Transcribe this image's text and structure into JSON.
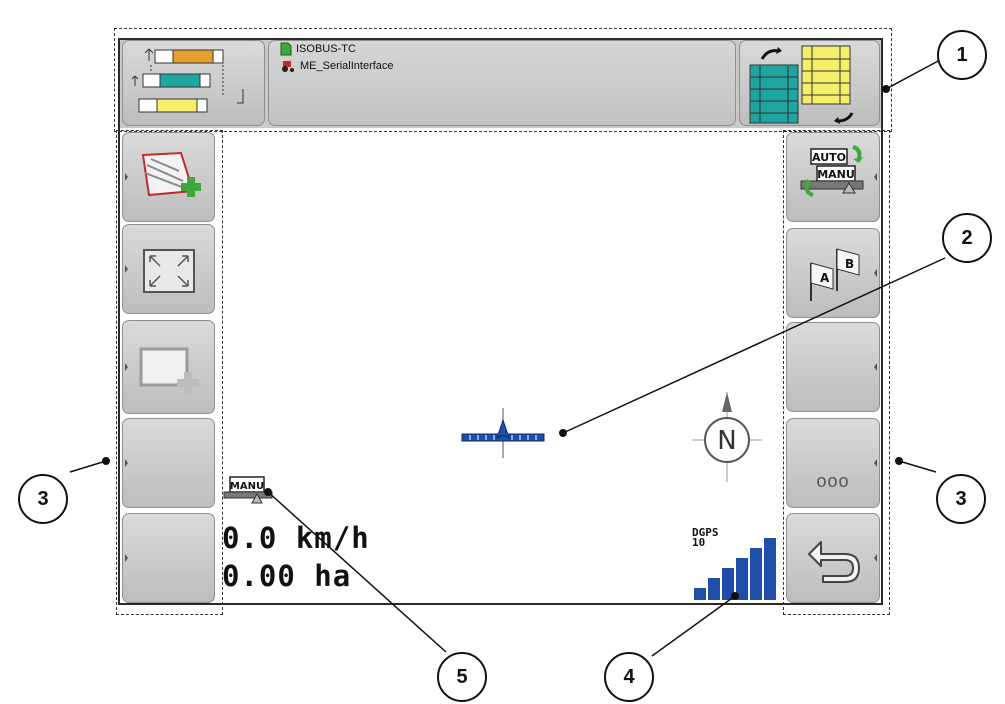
{
  "info": {
    "line1": "ISOBUS-TC",
    "line2": "ME_SerialInterface"
  },
  "readouts": {
    "speed": "0.0 km/h",
    "area": "0.00 ha"
  },
  "mode_badge": "MANU",
  "auto_manu_badge": {
    "top": "AUTO",
    "bottom": "MANU"
  },
  "ab_flags": {
    "a": "A",
    "b": "B"
  },
  "more_button": "ooo",
  "compass_letter": "N",
  "gps": {
    "label": "DGPS",
    "value": "10",
    "signal_level": 6,
    "signal_max": 6
  },
  "callouts": [
    "1",
    "2",
    "3",
    "3",
    "4",
    "5"
  ],
  "colors": {
    "accent_blue": "#1f4ea8",
    "teal": "#1fa6a0",
    "yellow": "#f4ee6a",
    "orange": "#e7a030",
    "edit_red": "#c02a2a",
    "add_green": "#3ea83a"
  }
}
